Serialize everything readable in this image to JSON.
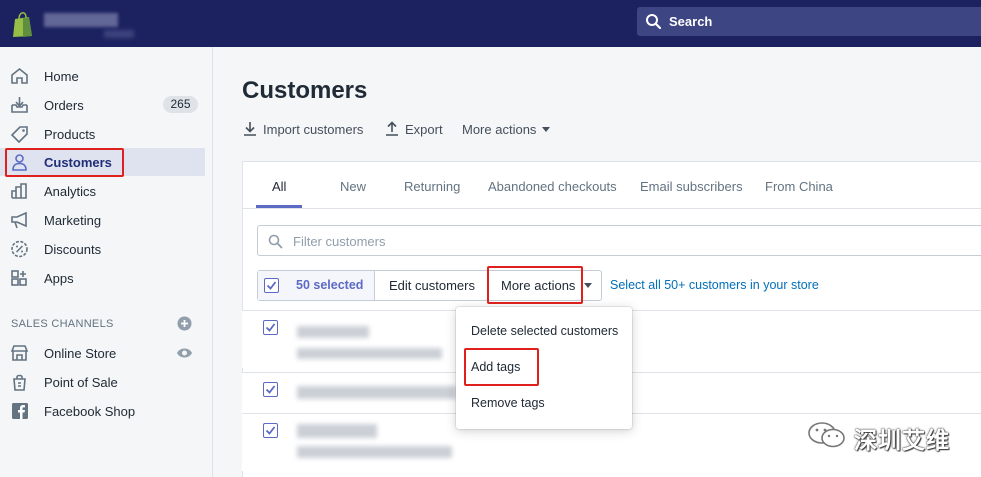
{
  "topbar": {
    "search_label": "Search"
  },
  "sidebar": {
    "items": [
      {
        "label": "Home",
        "icon": "home-icon"
      },
      {
        "label": "Orders",
        "icon": "orders-icon",
        "badge": "265"
      },
      {
        "label": "Products",
        "icon": "tag-icon"
      },
      {
        "label": "Customers",
        "icon": "person-icon",
        "active": true
      },
      {
        "label": "Analytics",
        "icon": "bar-chart-icon"
      },
      {
        "label": "Marketing",
        "icon": "megaphone-icon"
      },
      {
        "label": "Discounts",
        "icon": "discount-icon"
      },
      {
        "label": "Apps",
        "icon": "apps-icon"
      }
    ],
    "sales_channels_title": "SALES CHANNELS",
    "channels": [
      {
        "label": "Online Store",
        "icon": "store-icon"
      },
      {
        "label": "Point of Sale",
        "icon": "shopping-bag-icon"
      },
      {
        "label": "Facebook Shop",
        "icon": "facebook-icon"
      }
    ]
  },
  "main": {
    "title": "Customers",
    "import_label": "Import customers",
    "export_label": "Export",
    "more_actions_label": "More actions",
    "tabs": [
      "All",
      "New",
      "Returning",
      "Abandoned checkouts",
      "Email subscribers",
      "From China"
    ],
    "filter_placeholder": "Filter customers",
    "bulk": {
      "selected_label": "50 selected",
      "edit_label": "Edit customers",
      "more_label": "More actions",
      "select_all_link": "Select all 50+ customers in your store"
    },
    "dropdown": [
      "Delete selected customers",
      "Add tags",
      "Remove tags"
    ]
  },
  "watermark": "深圳艾维",
  "colors": {
    "topbar": "#1c2260",
    "accent": "#5c6ac4",
    "highlight": "#e0201c",
    "link": "#006fbb"
  }
}
